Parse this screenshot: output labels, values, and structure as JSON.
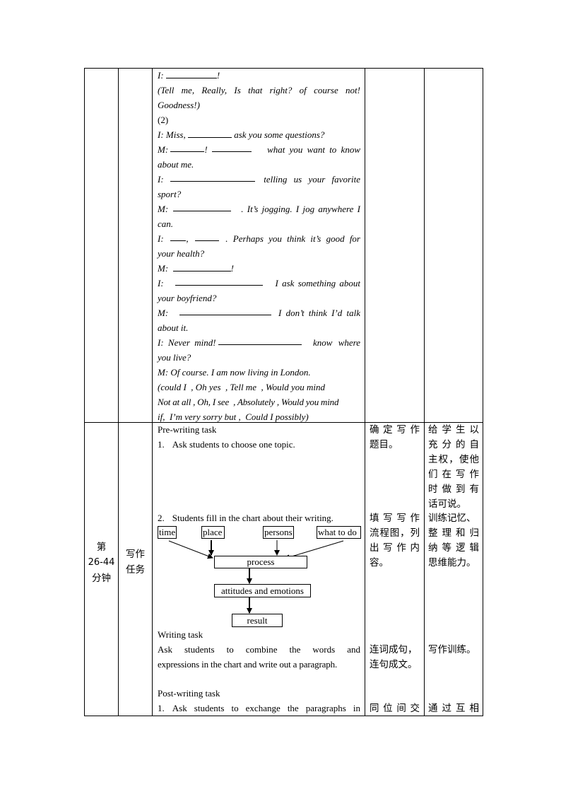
{
  "table": {
    "row1": {
      "dialogue_lines": [
        "I: ",
        "(Tell me, Really, Is that right? of course not!",
        "Goodness!)",
        "(2)",
        "I: Miss, ",
        "M: ",
        "about me.",
        "I: ",
        "sport?",
        "M: ",
        "can.",
        "I: ",
        "your health?",
        "M: ",
        "I: ",
        "your boyfriend?",
        "M: ",
        "about it.",
        "I: Never mind! ",
        "you live?",
        "M: Of course. I am now living in London.",
        "(could I  , Oh yes  , Tell me  , Would you mind",
        "Not at all , Oh, I see  , Absolutely , Would you mind",
        "if,  I’m very sorry but ,  Could I possibly)"
      ],
      "fragments": {
        "l1_end": "!",
        "l5_end": "ask you some questions?",
        "l6_mid": "!",
        "l6_end": "what you want to know",
        "l8_end": "telling us your favorite",
        "l10_end": ". It’s jogging. I jog anywhere I",
        "l12_mid": ",",
        "l12_end": ". Perhaps you think it’s good for",
        "l14_end": "!",
        "l15_end": "I ask something about",
        "l17_end": "I don’t think I’d talk",
        "l19_end": "know where"
      }
    },
    "row2": {
      "time_cell": [
        "第",
        "26-44",
        "分钟"
      ],
      "stage_cell": [
        "写作",
        "任务"
      ],
      "pre_writing_title": "Pre-writing task",
      "pre_item1_num": "1.",
      "pre_item1_text": "Ask students to choose one topic.",
      "pre_item2_num": "2.",
      "pre_item2_text": "Students fill in the chart about their writing.",
      "flowchart": {
        "top_boxes": [
          "time",
          "place",
          "persons",
          "what to do"
        ],
        "process": "process",
        "attitudes": "attitudes and emotions",
        "result": "result"
      },
      "writing_title": "Writing task",
      "writing_text_1": "Ask students to combine the words and",
      "writing_text_2": "expressions in the chart and write out a paragraph.",
      "post_writing_title": "Post-writing task",
      "post_item1_num": "1.",
      "post_item1_text": "Ask students to exchange the paragraphs in",
      "purpose_col": {
        "block1": [
          "确定写作",
          "题目。"
        ],
        "block2": [
          "填写写作",
          "流程图，列",
          "出写作内",
          "容。"
        ],
        "block3": [
          "连词成句，",
          "连句成文。"
        ],
        "block4": [
          "同位间交"
        ]
      },
      "intent_col": {
        "block1": [
          "给学生以",
          "充分的自",
          "主权，使他",
          "们在写作",
          "时做到有",
          "话可说。",
          "训练记忆、",
          "整理和归",
          "纳等逻辑",
          "思维能力。"
        ],
        "block2": [
          "写作训练。"
        ],
        "block3": [
          "通过互相"
        ]
      }
    }
  }
}
